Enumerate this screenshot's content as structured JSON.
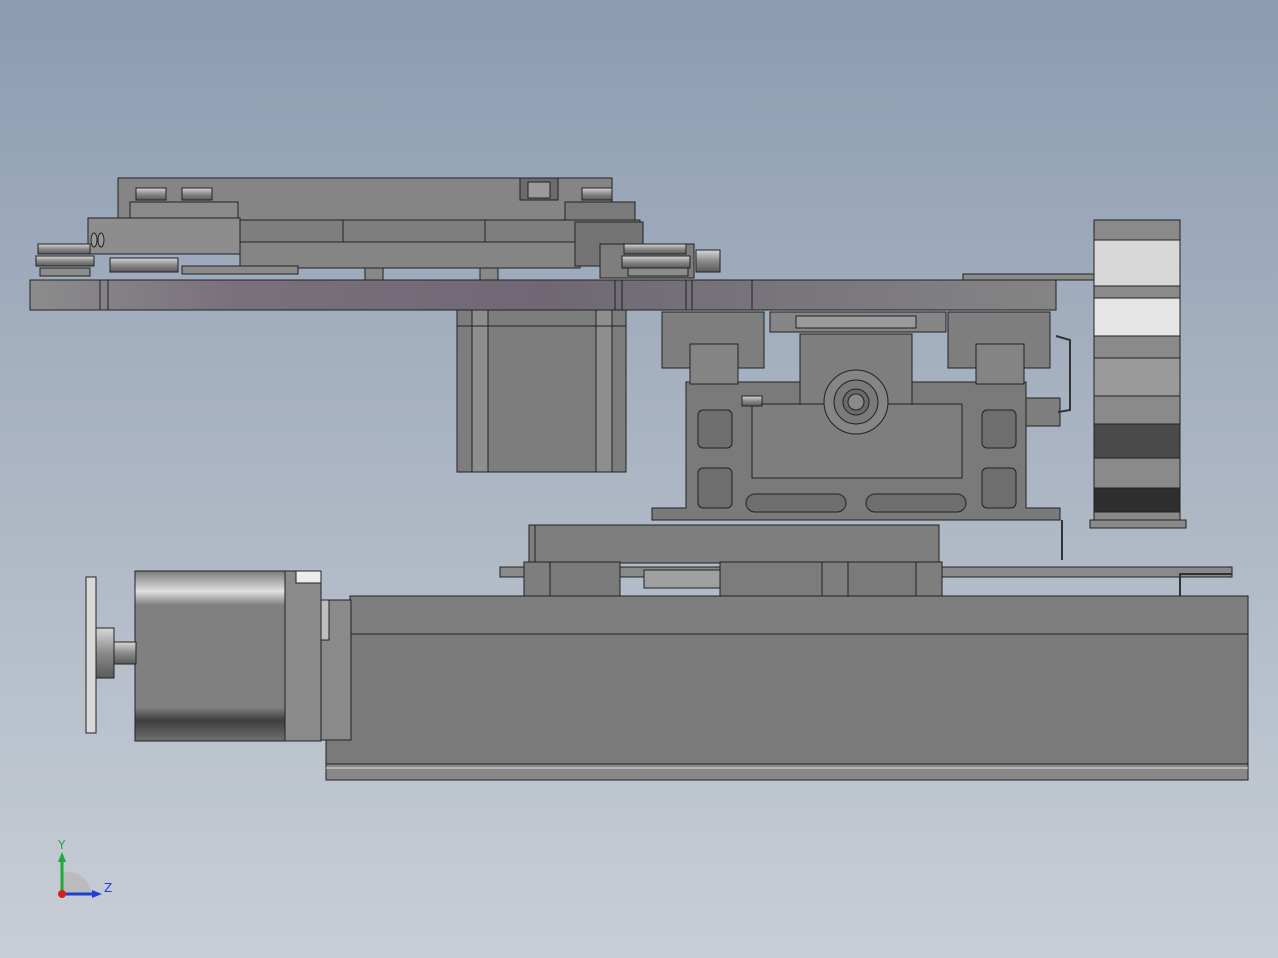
{
  "triad": {
    "y_label": "Y",
    "z_label": "Z",
    "y_color": "#1faa3a",
    "z_color": "#1f3fd4",
    "x_color": "#d42020"
  },
  "colors": {
    "background_top": "#8b9cb1",
    "background_bottom": "#c8ced6",
    "part_gray": "#7c7c7c",
    "outline": "#222222"
  }
}
